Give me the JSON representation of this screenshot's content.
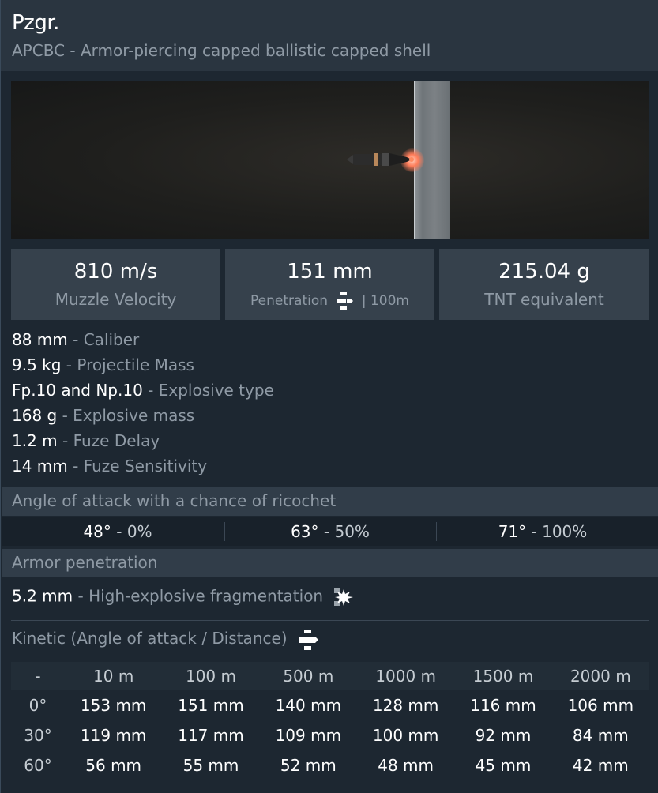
{
  "header": {
    "title": "Pzgr.",
    "subtitle": "APCBC - Armor-piercing capped ballistic capped shell"
  },
  "stats": {
    "velocity_value": "810 m/s",
    "velocity_label": "Muzzle Velocity",
    "penetration_value": "151 mm",
    "penetration_label": "Penetration",
    "penetration_distance": "| 100m",
    "tnt_value": "215.04 g",
    "tnt_label": "TNT equivalent"
  },
  "properties": [
    {
      "value": "88 mm",
      "label": "Caliber"
    },
    {
      "value": "9.5 kg",
      "label": "Projectile Mass"
    },
    {
      "value": "Fp.10 and Np.10",
      "label": "Explosive type"
    },
    {
      "value": "168 g",
      "label": "Explosive mass"
    },
    {
      "value": "1.2 m",
      "label": "Fuze Delay"
    },
    {
      "value": "14 mm",
      "label": "Fuze Sensitivity"
    }
  ],
  "ricochet": {
    "title": "Angle of attack with a chance of ricochet",
    "items": [
      {
        "angle": "48°",
        "chance": "0%"
      },
      {
        "angle": "63°",
        "chance": "50%"
      },
      {
        "angle": "71°",
        "chance": "100%"
      }
    ]
  },
  "armor": {
    "title": "Armor penetration",
    "he_value": "5.2 mm",
    "he_label": "High-explosive fragmentation",
    "kinetic_title": "Kinetic (Angle of attack / Distance)"
  },
  "penetration_table": {
    "corner": "-",
    "distances": [
      "10 m",
      "100 m",
      "500 m",
      "1000 m",
      "1500 m",
      "2000 m"
    ],
    "rows": [
      {
        "angle": "0°",
        "values": [
          "153 mm",
          "151 mm",
          "140 mm",
          "128 mm",
          "116 mm",
          "106 mm"
        ]
      },
      {
        "angle": "30°",
        "values": [
          "119 mm",
          "117 mm",
          "109 mm",
          "100 mm",
          "92 mm",
          "84 mm"
        ]
      },
      {
        "angle": "60°",
        "values": [
          "56 mm",
          "55 mm",
          "52 mm",
          "48 mm",
          "45 mm",
          "42 mm"
        ]
      }
    ]
  },
  "colors": {
    "background": "#1d2731",
    "header": "#2a3540",
    "stat_box": "#36414c",
    "section_bar": "#313d49",
    "muted_text": "#8f9aa5"
  }
}
